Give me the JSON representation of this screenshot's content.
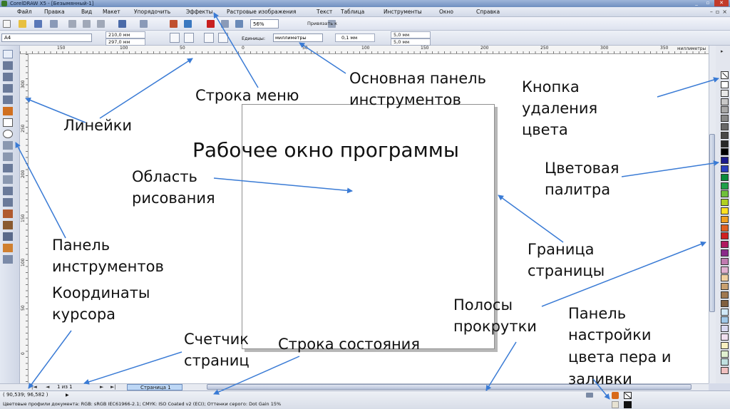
{
  "window": {
    "title": "CorelDRAW X5 - [Безымянный-1]",
    "buttons": [
      "_",
      "▫",
      "✕"
    ]
  },
  "menu": [
    "Файл",
    "Правка",
    "Вид",
    "Макет",
    "Упорядочить",
    "Эффекты",
    "Растровые изображения",
    "Текст",
    "Таблица",
    "Инструменты",
    "Окно",
    "Справка"
  ],
  "standard_toolbar": {
    "zoom": "56%",
    "snap": "Привязать к"
  },
  "property_bar": {
    "page_size": "A4",
    "width": "210,0 мм",
    "height": "297,0 мм",
    "units_label": "Единицы:",
    "units": "миллиметры",
    "nudge": "0,1 мм",
    "dup_x": "5,0 мм",
    "dup_y": "5,0 мм"
  },
  "ruler": {
    "h_numbers": [
      "150",
      "100",
      "50",
      "0",
      "50",
      "100",
      "150",
      "200",
      "250",
      "300",
      "350"
    ],
    "unit": "миллиметры",
    "v_numbers": [
      "300",
      "250",
      "200",
      "150",
      "100",
      "50",
      "0"
    ]
  },
  "page_counter": {
    "nav_first": "|◄",
    "nav_prev": "◄",
    "count": "1 из 1",
    "nav_next": "►",
    "nav_last": "►|",
    "tab": "Страница 1"
  },
  "status": {
    "coords": "( 90,539; 96,582 )",
    "profiles": "Цветовые профили документа: RGB: sRGB IEC61966-2.1; CMYK: ISO Coated v2 (ECI); Оттенки серого: Dot Gain 15%"
  },
  "palette": {
    "colors": [
      "#ffffff",
      "#e8e8e8",
      "#c8c8c8",
      "#a8a8a8",
      "#888888",
      "#686868",
      "#484848",
      "#282828",
      "#000000",
      "#1a1a8c",
      "#2a3fbf",
      "#0a8a3a",
      "#1fa04a",
      "#6fc03a",
      "#b0d020",
      "#ffe020",
      "#f0a020",
      "#e06020",
      "#d02020",
      "#b01a60",
      "#8a2a8a",
      "#c07ab0",
      "#e0b0d0",
      "#f0d0a0",
      "#c8a070",
      "#a07850",
      "#806040",
      "#d0e8f8",
      "#a0c8e8",
      "#d8d8f0",
      "#f0e0f0",
      "#f8f0c0",
      "#e0f0d0",
      "#c0e0e0",
      "#f0c0c0"
    ]
  },
  "annotations": {
    "title": "Рабочее окно программы",
    "menu_bar": "Строка меню",
    "toolbar": [
      "Основная панель",
      "инструментов"
    ],
    "rulers": "Линейки",
    "no_color": [
      "Кнопка",
      "удаления",
      "цвета"
    ],
    "drawing_area": [
      "Область",
      "рисования"
    ],
    "palette": [
      "Цветовая",
      "палитра"
    ],
    "toolbox": [
      "Панель",
      "инструментов"
    ],
    "page_border": [
      "Граница",
      "страницы"
    ],
    "cursor_coords": [
      "Координаты",
      "курсора"
    ],
    "scrollbars": [
      "Полосы",
      "прокрутки"
    ],
    "pen_fill": [
      "Панель",
      "настройки",
      "цвета пера и",
      "заливки"
    ],
    "page_counter": [
      "Счетчик",
      "страниц"
    ],
    "status_bar": "Строка состояния"
  }
}
